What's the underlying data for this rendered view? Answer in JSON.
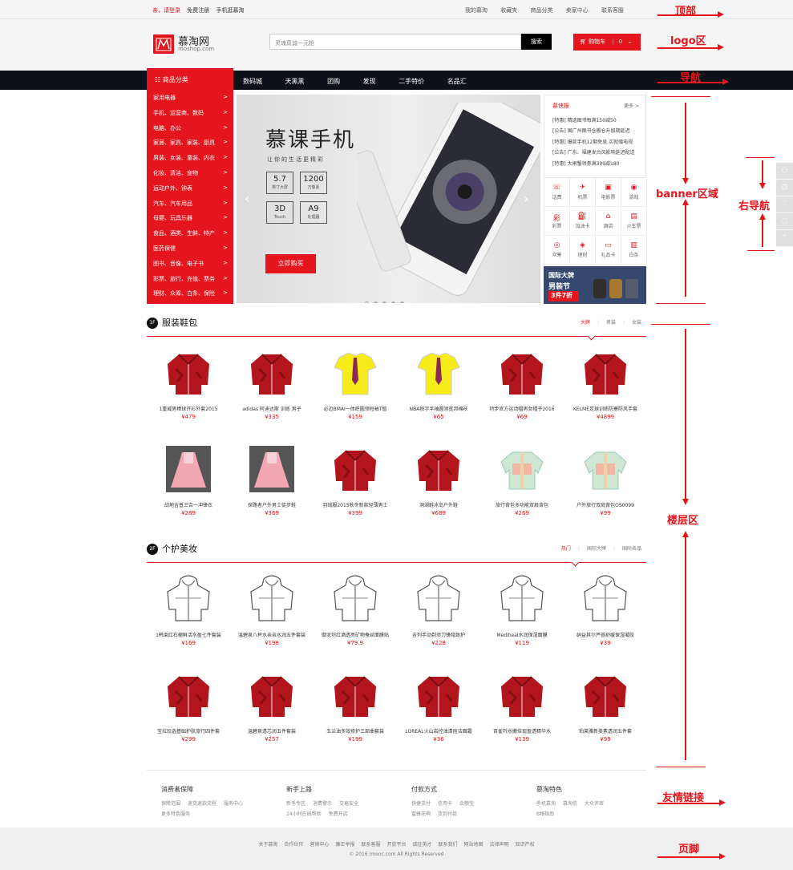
{
  "colors": {
    "brand": "#e4151c",
    "nav_bg": "#0b111a",
    "topbar_bg": "#f5f5f5"
  },
  "topbar": {
    "greeting": "亲，请登录",
    "register": "免费注册",
    "mobile": "手机逛慕淘",
    "right_items": [
      "我的慕淘",
      "收藏夹",
      "商品分类",
      "卖家中心",
      "联系客服"
    ]
  },
  "header": {
    "logo_title": "慕淘网",
    "logo_sub": "moshop.com",
    "search_placeholder": "灵魂真诚一元抢",
    "search_button": "搜索",
    "cart_label": "购物车",
    "cart_count": "0"
  },
  "nav": {
    "category_label": "商品分类",
    "items": [
      "数码城",
      "天黑黑",
      "团购",
      "发现",
      "二手特价",
      "名品汇"
    ]
  },
  "categories": [
    "家用电器",
    "手机、运营商、数码",
    "电脑、办公",
    "家居、家具、家装、厨具",
    "男装、女装、童装、内衣",
    "化妆、清洁、宠物",
    "运动户外、钟表",
    "汽车、汽车用品",
    "母婴、玩具乐器",
    "食品、酒类、生鲜、特产",
    "医药保健",
    "图书、音像、电子书",
    "彩票、旅行、充值、票务",
    "理财、众筹、白条、保险"
  ],
  "banner": {
    "title": "慕课手机",
    "subtitle": "让你的生活更精彩",
    "cta": "立即购买",
    "specs": [
      {
        "big": "5.7",
        "small": "英寸大屏"
      },
      {
        "big": "1200",
        "small": "万像素"
      },
      {
        "big": "3D",
        "small": "Touch"
      },
      {
        "big": "A9",
        "small": "处理器"
      }
    ]
  },
  "news": {
    "title": "慕快报",
    "more": "更多 >",
    "items": [
      "[特惠] 精选图书每满150减50",
      "[公告] 国广州图书仓搬仓升级期延迟",
      "[特惠] 爆款手机12期免息 买就赠电视",
      "[公告] 广东、福建发台风影响延迟配送",
      "[特惠] 大闸蟹领券满399减180"
    ]
  },
  "services": [
    {
      "icon": "phone-icon",
      "glyph": "☏",
      "label": "话费"
    },
    {
      "icon": "plane-icon",
      "glyph": "✈",
      "label": "机票"
    },
    {
      "icon": "movie-icon",
      "glyph": "▣",
      "label": "电影票"
    },
    {
      "icon": "game-icon",
      "glyph": "◉",
      "label": "游戏"
    },
    {
      "icon": "lottery-icon",
      "glyph": "彩",
      "label": "彩票"
    },
    {
      "icon": "fuel-icon",
      "glyph": "⛽",
      "label": "加油卡"
    },
    {
      "icon": "hotel-icon",
      "glyph": "⌂",
      "label": "酒店"
    },
    {
      "icon": "train-icon",
      "glyph": "▤",
      "label": "火车票"
    },
    {
      "icon": "crowdfund-icon",
      "glyph": "◎",
      "label": "众筹"
    },
    {
      "icon": "finance-icon",
      "glyph": "◈",
      "label": "理财"
    },
    {
      "icon": "giftcard-icon",
      "glyph": "▭",
      "label": "礼品卡"
    },
    {
      "icon": "baitiao-icon",
      "glyph": "▥",
      "label": "白条"
    }
  ],
  "promo": {
    "line1": "国际大牌",
    "line2": "男装节",
    "line3": "3件7折"
  },
  "sidebar_icons": [
    "user-icon",
    "cart-icon",
    "heart-icon",
    "chat-icon",
    "top-icon"
  ],
  "floors": [
    {
      "num": "1F",
      "title": "服装鞋包",
      "tabs": [
        "大牌",
        "男装",
        "女装"
      ],
      "products": [
        {
          "name": "1重威男棒球开衫外套2015",
          "price": "¥479",
          "img": "jacket"
        },
        {
          "name": "adidas 阿迪达斯 训练 男子",
          "price": "¥335",
          "img": "jacket"
        },
        {
          "name": "必迈BMAI一体织圆领短袖T恤",
          "price": "¥159",
          "img": "tshirt"
        },
        {
          "name": "NBA秋字半袖圆领宽邦棉袄",
          "price": "¥65",
          "img": "tshirt"
        },
        {
          "name": "特步官方运动帽男女帽子2016",
          "price": "¥69",
          "img": "jacket"
        },
        {
          "name": "KELME足球训练防寒防风手套",
          "price": "¥4899",
          "img": "jacket"
        },
        {
          "name": "战地吉普三合一冲锋衣",
          "price": "¥289",
          "img": "dress"
        },
        {
          "name": "探路者户外男士徒步鞋",
          "price": "¥369",
          "img": "dress"
        },
        {
          "name": "羽绒服2015秋冬新款轻薄男士",
          "price": "¥399",
          "img": "jacket"
        },
        {
          "name": "洞湖鞋冰岛户外鞋",
          "price": "¥689",
          "img": "jacket"
        },
        {
          "name": "旅行背包多功能双肩背包",
          "price": "¥269",
          "img": "kidcoat"
        },
        {
          "name": "户外旅行双肩背包OS0099",
          "price": "¥99",
          "img": "kidcoat"
        }
      ]
    },
    {
      "num": "2F",
      "title": "个护美妆",
      "tabs": [
        "热门",
        "国际大牌",
        "国际名品"
      ],
      "products": [
        {
          "name": "1韩束红石榴鲜活水盈七件套装",
          "price": "¥169",
          "img": "sketch"
        },
        {
          "name": "温碧泉八杯水亲亲水润五件套装",
          "price": "¥198",
          "img": "sketch"
        },
        {
          "name": "御泥坊红酒透亮矿物蚕丝面膜贴",
          "price": "¥79.9",
          "img": "sketch"
        },
        {
          "name": "吉列手动剃须刀锋隐致护",
          "price": "¥228",
          "img": "sketch"
        },
        {
          "name": "Mediheal水润保湿面膜",
          "price": "¥119",
          "img": "sketch"
        },
        {
          "name": "纳益其尔芦荟舒缓保湿凝胶",
          "price": "¥39",
          "img": "sketch"
        },
        {
          "name": "宝拉珍选基础护肤旅行四件套",
          "price": "¥299",
          "img": "jacket"
        },
        {
          "name": "温碧泉透芯润五件套装",
          "price": "¥257",
          "img": "jacket"
        },
        {
          "name": "玉兰油多效修护三部曲套装",
          "price": "¥199",
          "img": "jacket"
        },
        {
          "name": "LOREAL火山岩控油清痘洁面霜",
          "price": "¥36",
          "img": "jacket"
        },
        {
          "name": "百雀羚水嫩倍现盈透精华水",
          "price": "¥139",
          "img": "jacket"
        },
        {
          "name": "珀莱雅新美素透润五件套",
          "price": "¥99",
          "img": "jacket"
        }
      ]
    }
  ],
  "links": [
    {
      "title": "消费者保障",
      "items": [
        "保障范围",
        "退货退款流程",
        "服务中心",
        "更多特色服务"
      ]
    },
    {
      "title": "新手上路",
      "items": [
        "新手专区",
        "消费警示",
        "交易安全",
        "24小时在线帮助",
        "免费开店"
      ]
    },
    {
      "title": "付款方式",
      "items": [
        "快捷支付",
        "信用卡",
        "余额宝",
        "蜜蜂花啊",
        "货到付款"
      ]
    },
    {
      "title": "慕淘特色",
      "items": [
        "手机慕淘",
        "慕淘信",
        "大众评审",
        "B格指南"
      ]
    }
  ],
  "footer": {
    "items": [
      "关于慕淘",
      "合作伙伴",
      "营销中心",
      "廉正举报",
      "联系客服",
      "开放平台",
      "诚征英才",
      "联系我们",
      "网站地图",
      "法律声明",
      "知识产权"
    ],
    "copyright": "© 2016 imooc.com All Rights Reserved"
  },
  "annotations": {
    "top": "顶部",
    "logo": "logo区",
    "nav": "导航",
    "banner": "banner区域",
    "right_nav": "右导航",
    "floor": "楼层区",
    "links": "友情链接",
    "footer": "页脚"
  }
}
